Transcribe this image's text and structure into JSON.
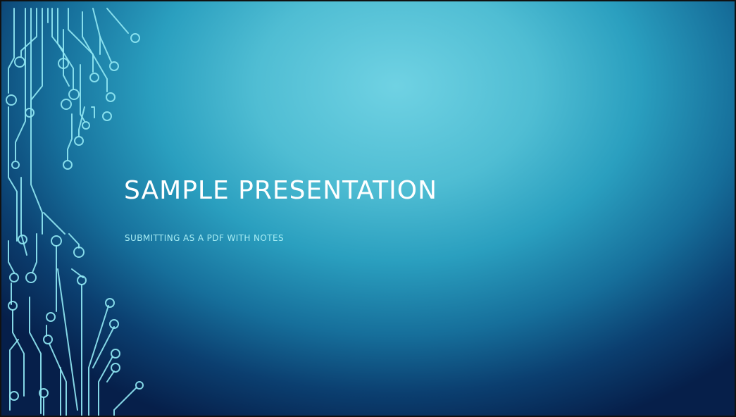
{
  "slide": {
    "title": "SAMPLE PRESENTATION",
    "subtitle": "SUBMITTING AS A PDF WITH NOTES",
    "decoration_icon": "circuit-lines"
  },
  "colors": {
    "background_light": "#6fd2e3",
    "background_dark": "#061f4a",
    "title": "#ffffff",
    "subtitle": "#a7edf4",
    "circuit": "#8fe6f2"
  }
}
